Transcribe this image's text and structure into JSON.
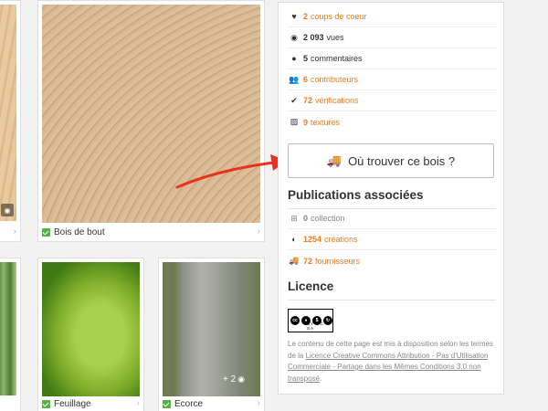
{
  "gallery": {
    "items": [
      {
        "caption": "Bois de bout"
      },
      {
        "caption": "Feuillage"
      },
      {
        "caption": "Ecorce",
        "extra_photos": "+ 2"
      }
    ]
  },
  "stats": [
    {
      "icon": "heart-icon",
      "num": "2",
      "label": "coups de coeur",
      "accent": true
    },
    {
      "icon": "eye-icon",
      "num": "2 093",
      "label": "vues",
      "accent": false
    },
    {
      "icon": "comment-icon",
      "num": "5",
      "label": "commentaires",
      "accent": false
    },
    {
      "icon": "contributors-icon",
      "num": "6",
      "label": "contributeurs",
      "accent": true
    },
    {
      "icon": "checkmark-icon",
      "num": "72",
      "label": "vérifications",
      "accent": true
    },
    {
      "icon": "texture-icon",
      "num": "9",
      "label": "textures",
      "accent": true
    }
  ],
  "find_button": "Où trouver ce bois ?",
  "publications": {
    "title": "Publications associées",
    "items": [
      {
        "icon": "collection-icon",
        "num": "0",
        "label": "collection",
        "accent": false
      },
      {
        "icon": "creations-icon",
        "num": "1254",
        "label": "créations",
        "accent": true
      },
      {
        "icon": "truck-icon",
        "num": "72",
        "label": "fournisseurs",
        "accent": true
      }
    ]
  },
  "licence": {
    "title": "Licence",
    "badge": "BY NC SA",
    "text_before": "Le contenu de cette page est mis à disposition selon les termes de la ",
    "link": "Licence Creative Commons Attribution - Pas d'Utilisation Commerciale - Partage dans les Mêmes Conditions 3.0 non transposé",
    "text_after": "."
  },
  "colors": {
    "accent": "#e67e22",
    "check": "#55b04a",
    "arrow": "#e8321e"
  }
}
